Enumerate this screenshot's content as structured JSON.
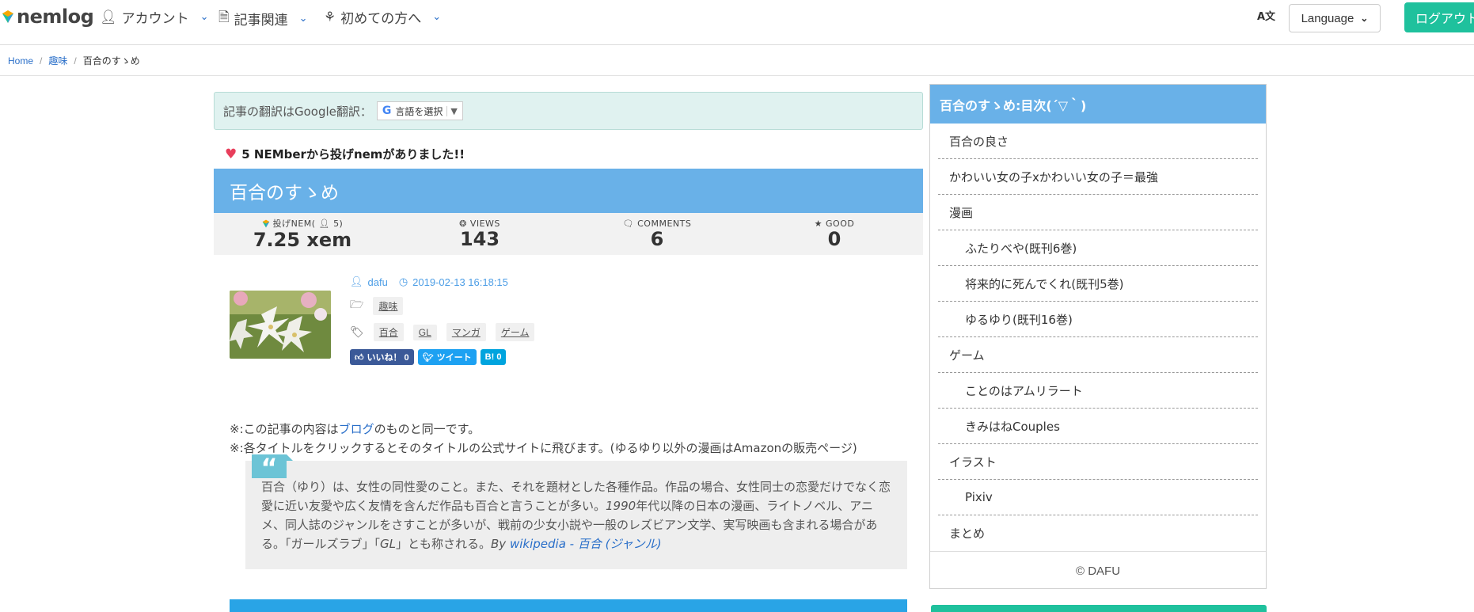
{
  "header": {
    "logo_text": "nemlog",
    "nav": [
      {
        "label": "アカウント"
      },
      {
        "label": "記事関連"
      },
      {
        "label": "初めての方へ"
      }
    ],
    "language_label": "Language",
    "logout_label": "ログアウト"
  },
  "breadcrumb": {
    "home": "Home",
    "category": "趣味",
    "current": "百合のすゝめ"
  },
  "translate": {
    "label": "記事の翻訳はGoogle翻訳：",
    "select_label": "言語を選択"
  },
  "nem_notice": "5 NEMberから投げnemがありました!!",
  "article": {
    "title": "百合のすゝめ",
    "stats": [
      {
        "label": "投げNEM(",
        "label_count": " 5)",
        "value": "7.25 xem"
      },
      {
        "label": "VIEWS",
        "value": "143"
      },
      {
        "label": "COMMENTS",
        "value": "6"
      },
      {
        "label": "GOOD",
        "value": "0"
      }
    ],
    "author": "dafu",
    "date": "2019-02-13 16:18:15",
    "category": "趣味",
    "tags": [
      "百合",
      "GL",
      "マンガ",
      "ゲーム"
    ],
    "share": {
      "fb": "いいね！ 0",
      "tw": "ツイート",
      "hb": "B! 0"
    },
    "note1_prefix": "※:この記事の内容は",
    "note1_link": "ブログ",
    "note1_suffix": "のものと同一です。",
    "note2": "※:各タイトルをクリックするとそのタイトルの公式サイトに飛びます。(ゆるゆり以外の漫画はAmazonの販売ページ)",
    "quote_text_1": "百合（ゆり）は、女性の同性愛のこと。また、それを題材とした各種作品。作品の場合、女性同士の恋愛だけでなく恋愛に近い友愛や広く友情を含んだ作品も百合と言うことが多い。",
    "quote_text_italic": "1990",
    "quote_text_2": "年代以降の日本の漫画、ライトノベル、アニメ、同人誌のジャンルをさすことが多いが、戦前の少女小説や一般のレズビアン文学、実写映画も含まれる場合がある。「ガールズラブ」「",
    "quote_text_gl": "GL",
    "quote_text_3": "」とも称される。",
    "quote_by": "By",
    "quote_link": "wikipedia - 百合 (ジャンル)"
  },
  "toc": {
    "title": "百合のすゝめ:目次(´▽｀)",
    "items": [
      {
        "label": "百合の良さ",
        "sub": false
      },
      {
        "label": "かわいい女の子xかわいい女の子＝最強",
        "sub": false
      },
      {
        "label": "漫画",
        "sub": false
      },
      {
        "label": "ふたりべや(既刊6巻)",
        "sub": true
      },
      {
        "label": "将来的に死んでくれ(既刊5巻)",
        "sub": true
      },
      {
        "label": "ゆるゆり(既刊16巻)",
        "sub": true
      },
      {
        "label": "ゲーム",
        "sub": false
      },
      {
        "label": "ことのはアムリラート",
        "sub": true
      },
      {
        "label": "きみはねCouples",
        "sub": true
      },
      {
        "label": "イラスト",
        "sub": false
      },
      {
        "label": "Pixiv",
        "sub": true
      },
      {
        "label": "まとめ",
        "sub": false
      }
    ],
    "copyright": "© DAFU"
  }
}
